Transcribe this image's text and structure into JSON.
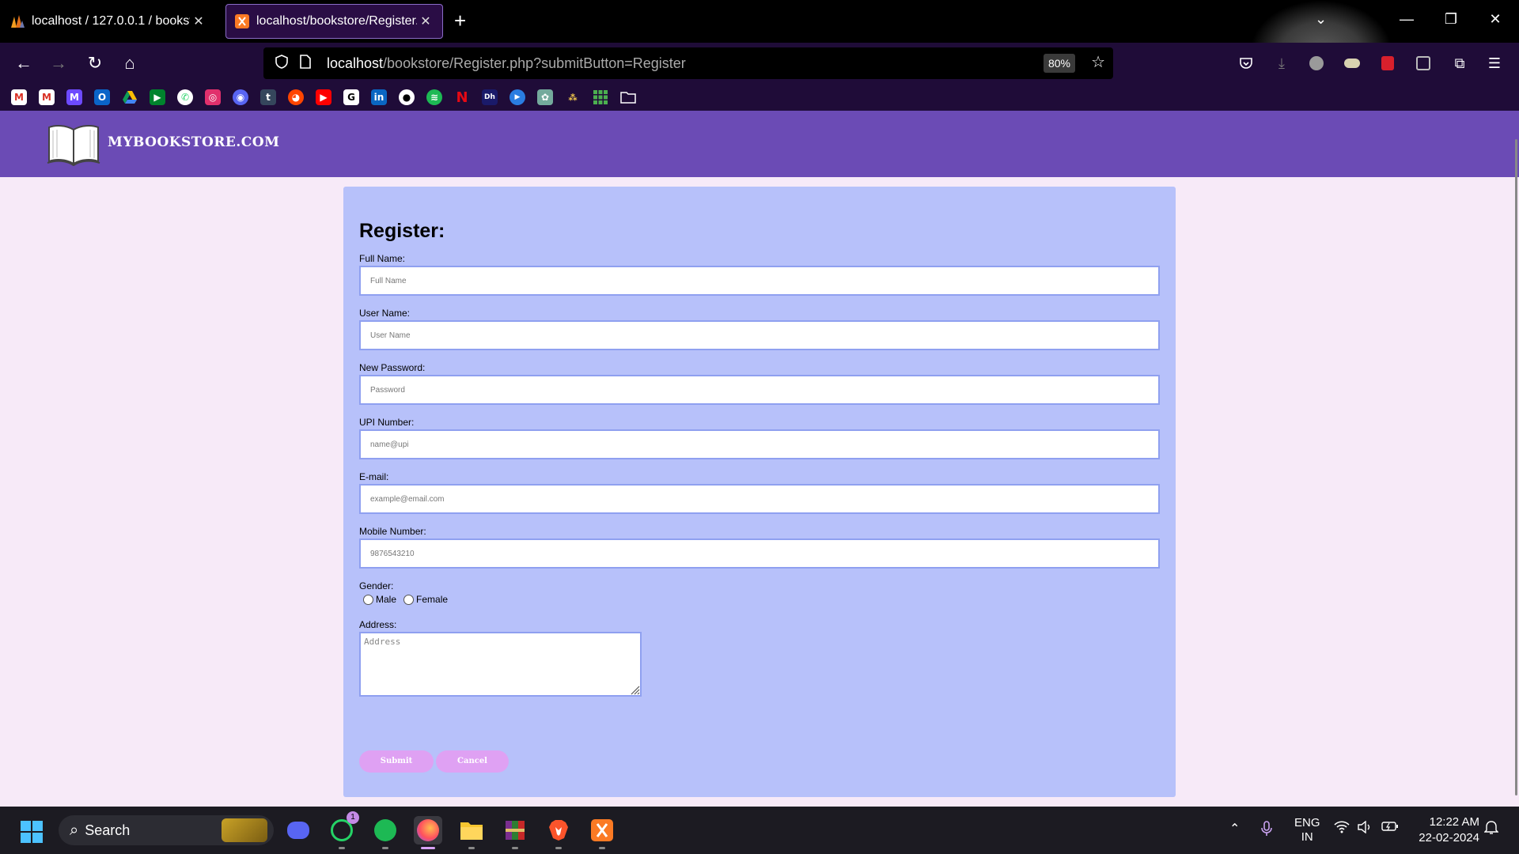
{
  "browser": {
    "tabs": [
      {
        "title": "localhost / 127.0.0.1 / bookstore",
        "active": false
      },
      {
        "title": "localhost/bookstore/Register.php",
        "active": true
      }
    ],
    "url_host": "localhost",
    "url_path": "/bookstore/Register.php?submitButton=Register",
    "zoom": "80%",
    "bookmarks": [
      "gmail",
      "gmail",
      "proton-mail",
      "outlook",
      "google-drive",
      "google-meet",
      "whatsapp",
      "instagram",
      "discord",
      "tumblr",
      "reddit",
      "youtube",
      "grammarly",
      "linkedin",
      "github",
      "spotify",
      "netflix",
      "digital-hub",
      "play",
      "chatgpt",
      "misc",
      "apps-grid",
      "folder"
    ]
  },
  "site": {
    "name": "MYBOOKSTORE.COM"
  },
  "form": {
    "title": "Register:",
    "fields": [
      {
        "label": "Full Name:",
        "placeholder": "Full Name"
      },
      {
        "label": "User Name:",
        "placeholder": "User Name"
      },
      {
        "label": "New Password:",
        "placeholder": "Password"
      },
      {
        "label": "UPI Number:",
        "placeholder": "name@upi"
      },
      {
        "label": "E-mail:",
        "placeholder": "example@email.com"
      },
      {
        "label": "Mobile Number:",
        "placeholder": "9876543210"
      }
    ],
    "gender": {
      "label": "Gender:",
      "options": [
        "Male",
        "Female"
      ]
    },
    "address": {
      "label": "Address:",
      "placeholder": "Address"
    },
    "submit_label": "Submit",
    "cancel_label": "Cancel"
  },
  "taskbar": {
    "search_label": "Search",
    "whatsapp_badge": "1",
    "language": "ENG",
    "region": "IN",
    "time": "12:22 AM",
    "date": "22-02-2024"
  },
  "colors": {
    "header": "#6b4bb5",
    "card": "#b7c1fa",
    "page_bg": "#f7eaf8",
    "button": "#dfa1f3"
  }
}
